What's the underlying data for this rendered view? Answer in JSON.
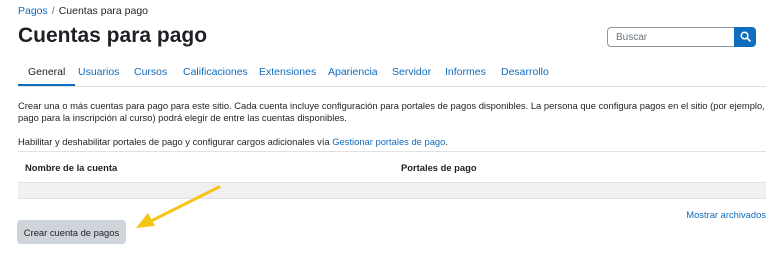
{
  "breadcrumb": {
    "items": [
      "Pagos",
      "Cuentas para pago"
    ],
    "separator": "/"
  },
  "page_title": "Cuentas para pago",
  "search": {
    "placeholder": "Buscar",
    "icon": "search-icon"
  },
  "tabs": [
    {
      "label": "General",
      "active": true
    },
    {
      "label": "Usuarios"
    },
    {
      "label": "Cursos"
    },
    {
      "label": "Calificaciones"
    },
    {
      "label": "Extensiones"
    },
    {
      "label": "Apariencia"
    },
    {
      "label": "Servidor"
    },
    {
      "label": "Informes"
    },
    {
      "label": "Desarrollo"
    }
  ],
  "description": "Crear una o más cuentas para pago para este sitio. Cada cuenta incluye configuración para portales de pagos disponibles. La persona que configura pagos en el sitio (por ejemplo, pago para la inscripción al curso) podrá elegir de entre las cuentas disponibles.",
  "manage": {
    "text": "Habilitar y deshabilitar portales de pago y configurar cargos adicionales vía ",
    "link": "Gestionar portales de pago",
    "suffix": "."
  },
  "table": {
    "headers": [
      "Nombre de la cuenta",
      "Portales de pago"
    ],
    "rows": []
  },
  "show_archived": "Mostrar archivados",
  "create_button": "Crear cuenta de pagos",
  "colors": {
    "link": "#0f6cbf",
    "annotation_arrow": "#f5c518",
    "button_bg": "#ced4da"
  }
}
